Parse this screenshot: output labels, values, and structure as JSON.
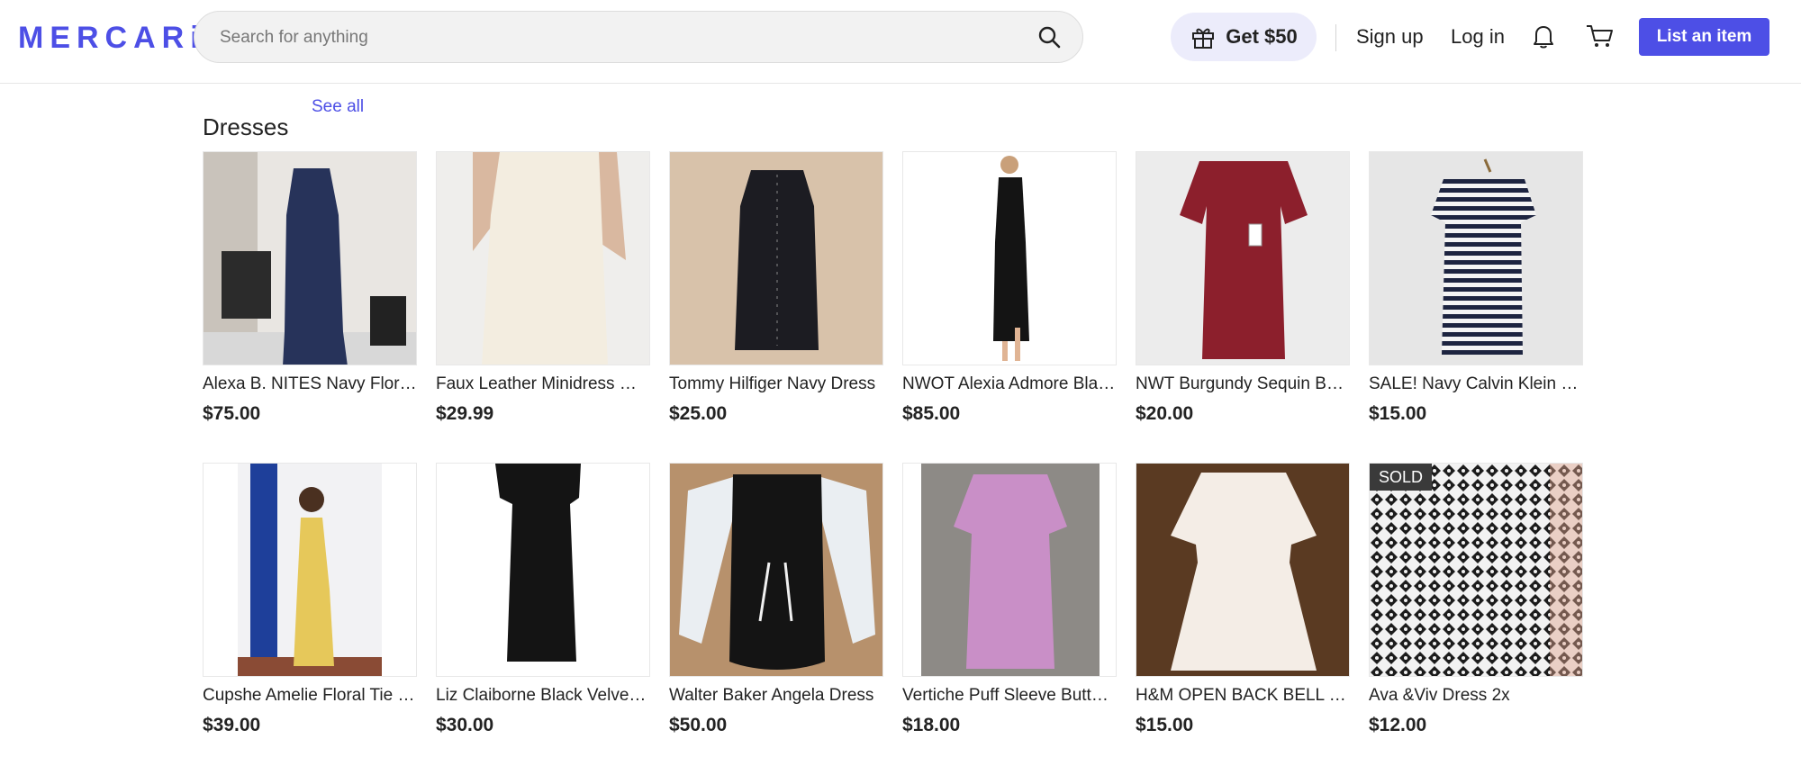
{
  "header": {
    "logo": "MERCARi",
    "search_placeholder": "Search for anything",
    "promo_label": "Get $50",
    "signup_label": "Sign up",
    "login_label": "Log in",
    "list_item_label": "List an item",
    "brand_color": "#4d4fe6"
  },
  "section": {
    "title": "Dresses",
    "see_all": "See all"
  },
  "items": [
    {
      "name": "Alexa B. NITES Navy Floral Lace Dress",
      "price": "$75.00",
      "sold": false
    },
    {
      "name": "Faux Leather Minidress Mango",
      "price": "$29.99",
      "sold": false
    },
    {
      "name": "Tommy Hilfiger Navy Dress",
      "price": "$25.00",
      "sold": false
    },
    {
      "name": "NWOT Alexia Admore Black Dress",
      "price": "$85.00",
      "sold": false
    },
    {
      "name": "NWT Burgundy Sequin Bodycon Dress",
      "price": "$20.00",
      "sold": false
    },
    {
      "name": "SALE! Navy Calvin Klein Striped Dress",
      "price": "$15.00",
      "sold": false
    },
    {
      "name": "Cupshe Amelie Floral Tie Back Dress",
      "price": "$39.00",
      "sold": false
    },
    {
      "name": "Liz Claiborne Black Velvet Dress",
      "price": "$30.00",
      "sold": false
    },
    {
      "name": "Walter Baker Angela Dress",
      "price": "$50.00",
      "sold": false
    },
    {
      "name": "Vertiche Puff Sleeve Button Dress",
      "price": "$18.00",
      "sold": false
    },
    {
      "name": "H&M OPEN BACK BELL SLEEVE DRESS",
      "price": "$15.00",
      "sold": false
    },
    {
      "name": "Ava &Viv Dress 2x",
      "price": "$12.00",
      "sold": true,
      "sold_label": "SOLD"
    }
  ]
}
